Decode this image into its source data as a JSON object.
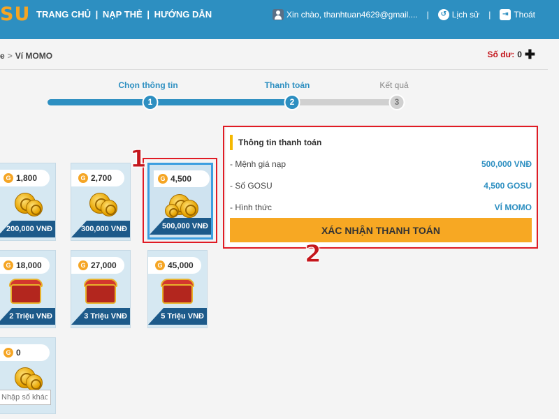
{
  "header": {
    "logo": "SU",
    "nav": [
      "TRANG CHỦ",
      "NẠP THẺ",
      "HƯỚNG DẪN"
    ],
    "nav_separator": "|",
    "greeting": "Xin chào, thanhtuan4629@gmail....",
    "history": "Lịch sử",
    "logout": "Thoát"
  },
  "breadcrumb": {
    "prev": "e",
    "separator": ">",
    "current": "Ví MOMO"
  },
  "balance": {
    "label": "Số dư:",
    "value": "0",
    "add_symbol": "✚"
  },
  "stepper": {
    "steps": [
      {
        "label": "Chọn thông tin",
        "number": "1",
        "state": "done"
      },
      {
        "label": "Thanh toán",
        "number": "2",
        "state": "current"
      },
      {
        "label": "Kết quả",
        "number": "3",
        "state": "pending"
      }
    ]
  },
  "packages": [
    {
      "gosu": "1,800",
      "price": "200,000 VNĐ",
      "icon": "coin-stack"
    },
    {
      "gosu": "2,700",
      "price": "300,000 VNĐ",
      "icon": "coin-stack"
    },
    {
      "gosu": "4,500",
      "price": "500,000 VNĐ",
      "icon": "coin-stack",
      "selected": true
    },
    {
      "gosu": "18,000",
      "price": "2 Triệu VNĐ",
      "icon": "treasure-chest"
    },
    {
      "gosu": "27,000",
      "price": "3 Triệu VNĐ",
      "icon": "treasure-chest"
    },
    {
      "gosu": "45,000",
      "price": "5 Triệu VNĐ",
      "icon": "treasure-chest"
    },
    {
      "gosu": "0",
      "price": "",
      "icon": "coin-stack",
      "input_placeholder": "Nhập số khác"
    }
  ],
  "payment": {
    "title": "Thông tin thanh toán",
    "rows": [
      {
        "key": "- Mệnh giá nạp",
        "value": "500,000 VNĐ"
      },
      {
        "key": "- Số GOSU",
        "value": "4,500 GOSU"
      },
      {
        "key": "- Hình thức",
        "value": "VÍ MOMO"
      }
    ],
    "confirm_label": "XÁC NHẬN THANH TOÁN"
  },
  "annotations": {
    "marker_1": "1",
    "marker_2": "2"
  },
  "colors": {
    "header": "#2d8fc1",
    "accent": "#f7a823",
    "highlight": "#e01b24"
  }
}
